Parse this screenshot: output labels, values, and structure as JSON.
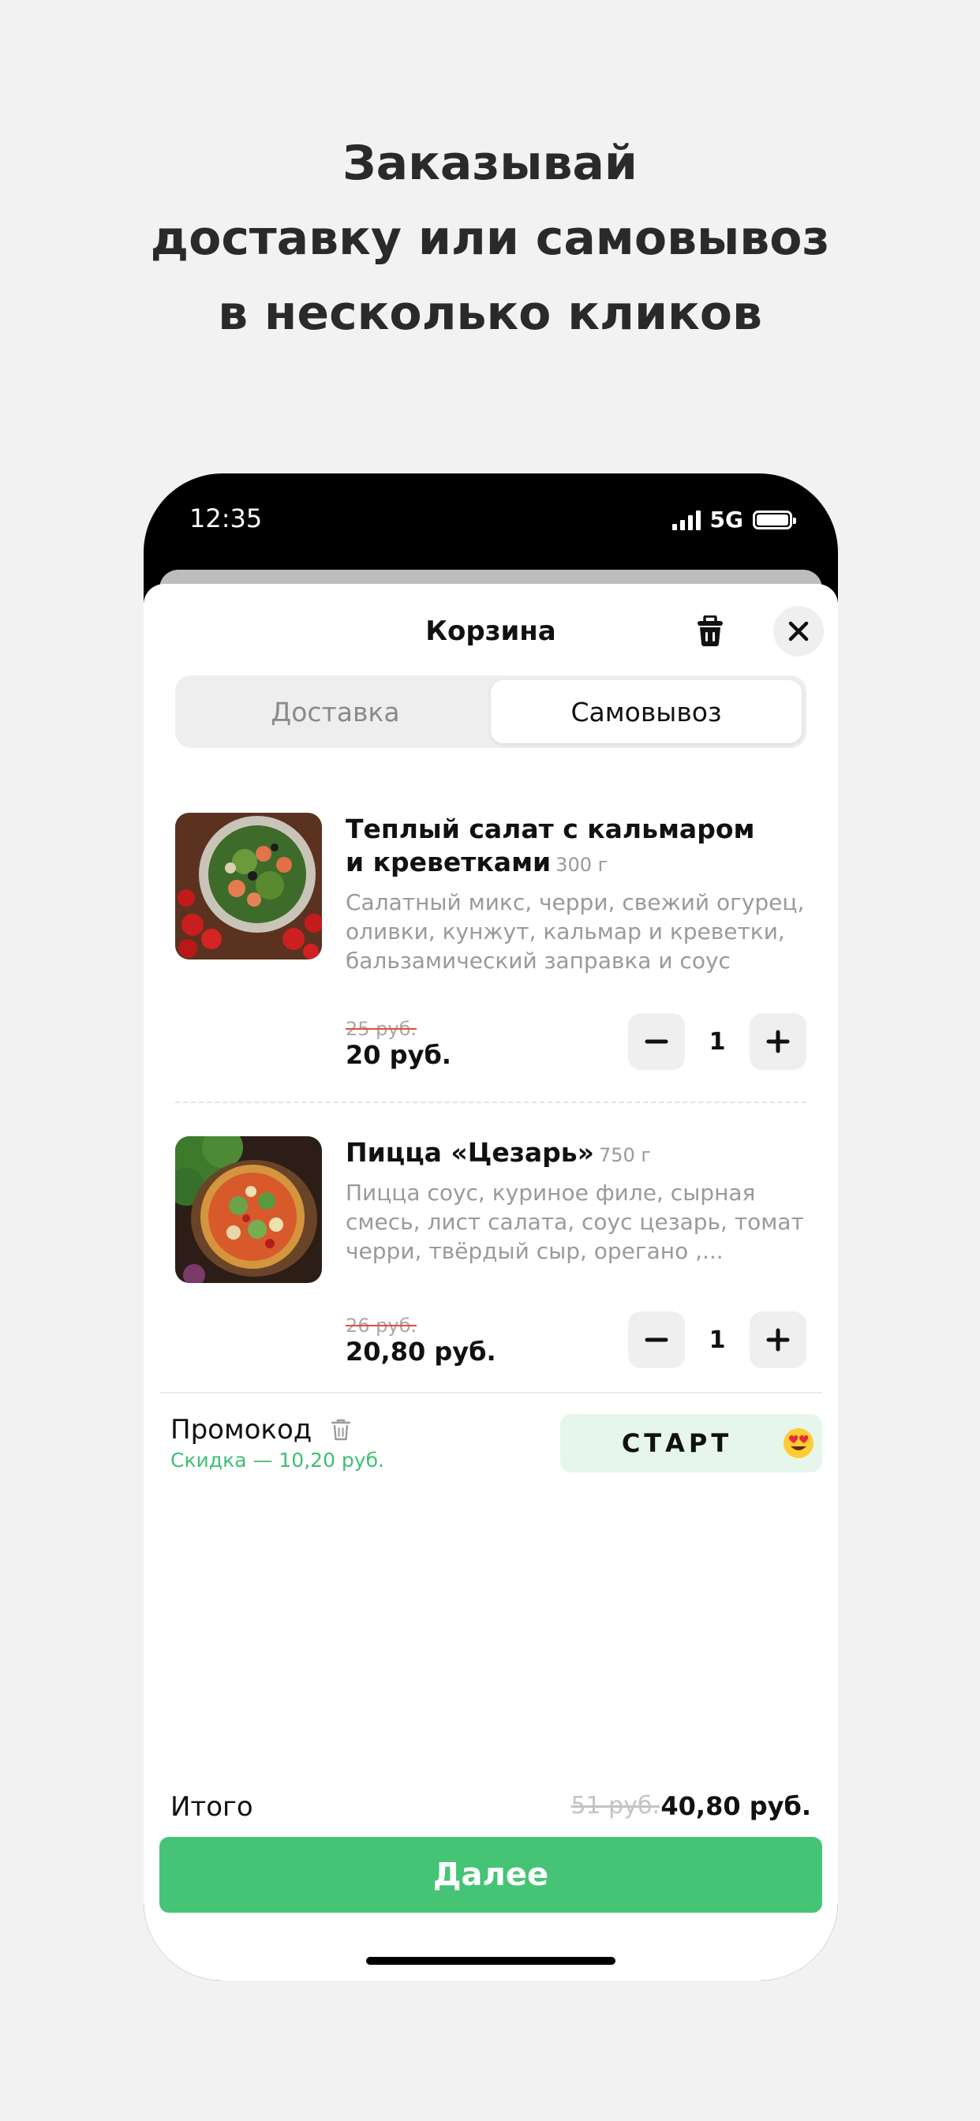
{
  "headline": {
    "line1": "Заказывай",
    "line2": "доставку или самовывоз",
    "line3": "в несколько кликов"
  },
  "status_bar": {
    "time": "12:35",
    "network": "5G",
    "icons": [
      "signal-icon",
      "battery-icon"
    ]
  },
  "cart": {
    "title": "Корзина",
    "icons": [
      "trash-icon",
      "close-icon"
    ],
    "tabs": [
      {
        "label": "Доставка",
        "active": false
      },
      {
        "label": "Самовывоз",
        "active": true
      }
    ],
    "items": [
      {
        "name_line1": "Теплый салат с кальмаром",
        "name_line2": "и креветками",
        "weight": "300 г",
        "description": "Салатный микс, черри, свежий огурец, оливки, кунжут, кальмар и креветки, бальзамический заправка и соус",
        "old_price": "25 руб.",
        "price": "20 руб.",
        "quantity": "1"
      },
      {
        "name_line1": "Пицца «Цезарь»",
        "weight": "750 г",
        "description": "Пицца соус, куриное филе, сырная смесь, лист салата, соус цезарь, томат черри, твёрдый сыр, орегано ,...",
        "old_price": "26 руб.",
        "price": "20,80 руб.",
        "quantity": "1"
      }
    ],
    "promo": {
      "label": "Промокод",
      "discount": "Скидка — 10,20 руб.",
      "code": "СТАРТ",
      "emoji": "heart-eyes-emoji-icon"
    },
    "total": {
      "label": "Итого",
      "old": "51 руб.",
      "value": "40,80 руб."
    },
    "next_label": "Далее"
  },
  "colors": {
    "accent_green": "#45c476",
    "discount_green": "#3fbf74",
    "promo_bg": "#e6f6ec",
    "strike_red": "#e74c3c",
    "page_bg": "#f2f2f2"
  }
}
